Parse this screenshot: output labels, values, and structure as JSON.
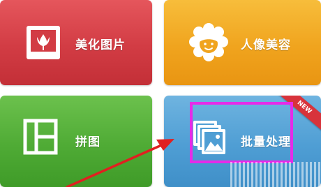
{
  "tiles": {
    "beautify": {
      "label": "美化图片",
      "icon": "flower-photo-icon",
      "color": "#d23c44"
    },
    "portrait": {
      "label": "人像美容",
      "icon": "smiling-face-icon",
      "color": "#f0a41e"
    },
    "collage": {
      "label": "拼图",
      "icon": "collage-layout-icon",
      "color": "#4fab35"
    },
    "batch": {
      "label": "批量处理",
      "icon": "stacked-photos-icon",
      "color": "#4f9ed4",
      "badge": "NEW"
    }
  },
  "annotations": {
    "highlight_color": "#e62be8",
    "arrow_color": "#e02020"
  }
}
